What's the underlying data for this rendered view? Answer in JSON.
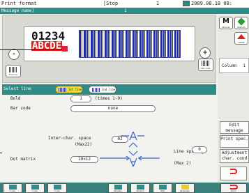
{
  "statusbar": {
    "title": "Print format",
    "state": "[Stop",
    "counter": "1",
    "datetime": "2009.08.18 08:"
  },
  "message_bar": {
    "label": "Message name]",
    "value": "1"
  },
  "preview": {
    "minus_label": "-",
    "plus_label": "+",
    "left_button_caption": "Preview",
    "right_button_caption": "Barcode",
    "numeric_text": "01234",
    "alpha_text": "ABCDE"
  },
  "right_panel": {
    "manual_label": "M",
    "manual_caption": "Manual",
    "startup_caption": "StartUp",
    "home_caption": "HOME",
    "column_label": "Column",
    "column_value": "1",
    "edit_message": "Edit message",
    "print_spec": "Print spec.",
    "adjustment": "Adjustment char. cond"
  },
  "settings": {
    "select_line_label": "Select line",
    "line_btn_1": "1st line",
    "line_btn_2": "2nd line",
    "bold_label": "Bold",
    "bold_value": "1",
    "bold_range": "(times 1-9)",
    "barcode_label": "Bar code",
    "barcode_value": "none",
    "inter_char_label": "Inter-char. space",
    "inter_char_max": "(Max22)",
    "inter_char_value": "02",
    "line_spacing_label": "Line spacing",
    "line_spacing_max": "(Max 2)",
    "line_spacing_value": "0",
    "dot_matrix_label": "Dot matrix",
    "dot_matrix_value": "10x12"
  },
  "bottom_bar": {
    "buttons": [
      "Line",
      "Line",
      "Line",
      "Delete",
      "Insert",
      "Add",
      "Calendar"
    ],
    "exit_caption": "Exit"
  },
  "colors": {
    "teal": "#2e8c86",
    "red": "#e0201f",
    "barcode_blue": "#1f2aa0",
    "highlight_yellow": "#e9dc3c"
  }
}
